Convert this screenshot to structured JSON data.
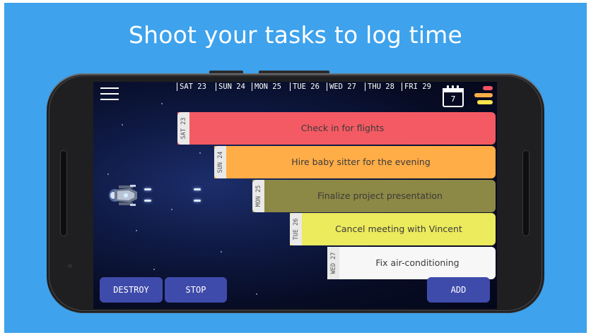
{
  "headline": "Shoot your tasks to log time",
  "days": [
    "SAT 23",
    "SUN 24",
    "MON 25",
    "TUE 26",
    "WED 27",
    "THU 28",
    "FRI 29"
  ],
  "calendar": {
    "icon": "calendar-icon",
    "day": "7"
  },
  "menu_icon": "hamburger-menu-icon",
  "legend": {
    "icon": "color-legend-icon",
    "colors": [
      "#f25262",
      "#ffad47",
      "#ffe44d"
    ]
  },
  "tasks": [
    {
      "day": "SAT 23",
      "title": "Check in for flights",
      "color": "#f45a63"
    },
    {
      "day": "SUN 24",
      "title": "Hire baby sitter for the evening",
      "color": "#ffad47"
    },
    {
      "day": "MON 25",
      "title": "Finalize project presentation",
      "color": "#8c8845"
    },
    {
      "day": "TUE 26",
      "title": "Cancel meeting with Vincent",
      "color": "#ecea5d"
    },
    {
      "day": "WED 27",
      "title": "Fix air-conditioning",
      "color": "#f7f7f7"
    }
  ],
  "buttons": {
    "destroy": "DESTROY",
    "stop": "STOP",
    "add": "ADD"
  },
  "colors": {
    "background": "#3ea2ec",
    "button": "#3f4bab",
    "screen": "#0a1336"
  }
}
